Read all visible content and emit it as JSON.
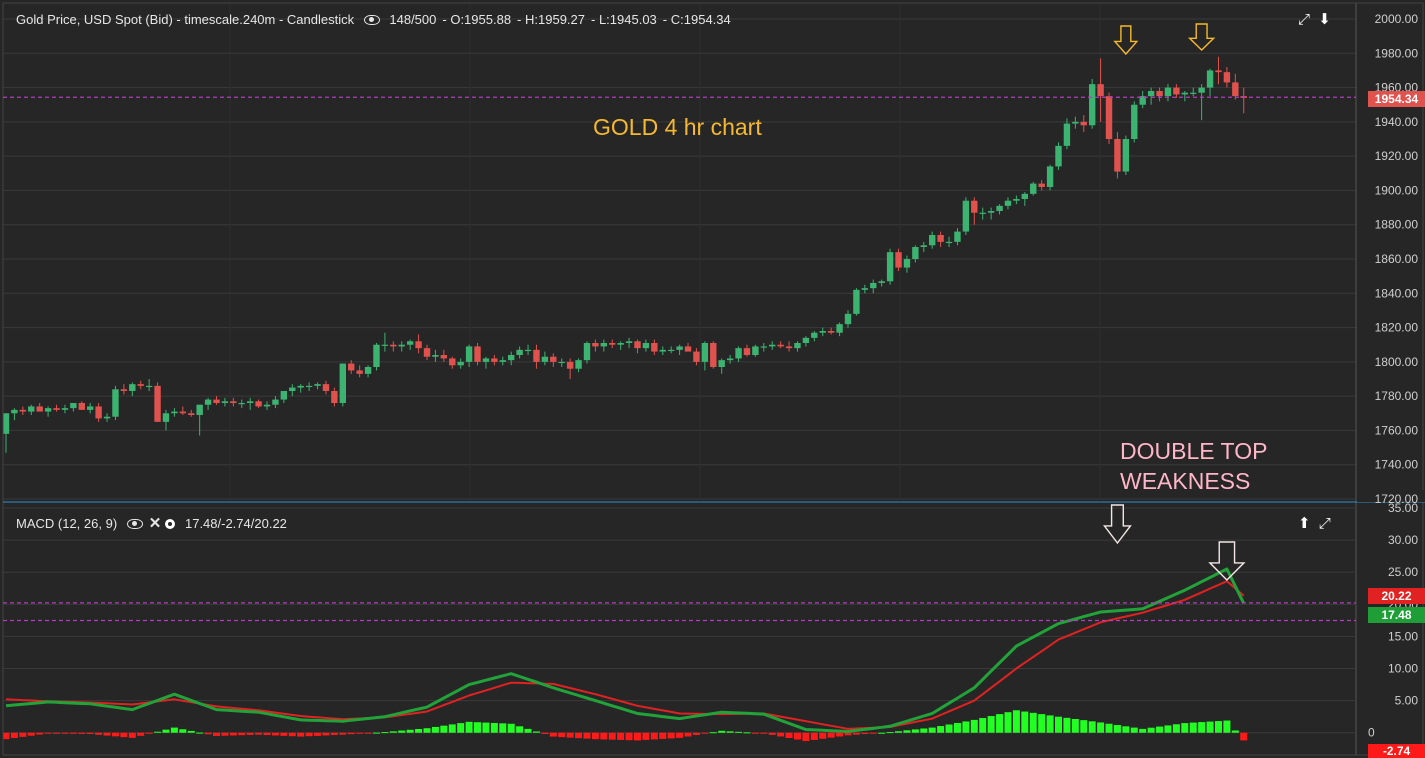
{
  "colors": {
    "background": "#262626",
    "grid": "#3a3a3a",
    "up_candle": "#3cb371",
    "down_candle": "#e0524e",
    "price_line": "#b03fbf",
    "annotation_gold": "#f5b82e",
    "annotation_pink": "#ffb6c8",
    "macd_line": "#22a33a",
    "signal_line": "#e02222",
    "hist_pos": "#22ff22",
    "hist_neg": "#ff1a1a",
    "separator": "#2f8fcf"
  },
  "price_chart": {
    "header": {
      "title": "Gold Price, USD Spot (Bid) - timescale.240m - Candlestick",
      "bars": "148/500",
      "open": "O:1955.88",
      "high": "H:1959.27",
      "low": "L:1945.03",
      "close": "C:1954.34"
    },
    "icons": [
      "eye-icon",
      "expand-icon",
      "arrow-down-icon"
    ],
    "current_price": "1954.34",
    "annotation": "GOLD 4 hr chart"
  },
  "macd_chart": {
    "header": {
      "title": "MACD (12, 26, 9)",
      "values": "17.48/-2.74/20.22"
    },
    "icons": [
      "eye-icon",
      "close-icon",
      "gear-icon",
      "arrow-up-icon",
      "expand-icon"
    ],
    "macd_value": "17.48",
    "signal_value": "20.22",
    "hist_value": "-2.74",
    "annotation_line1": "DOUBLE TOP",
    "annotation_line2": "WEAKNESS"
  },
  "chart_data": [
    {
      "type": "candlestick",
      "title": "Gold Price, USD Spot (Bid) - timescale.240m - Candlestick",
      "ylim": [
        1720,
        2000
      ],
      "y_ticks": [
        "2000.00",
        "1980.00",
        "1960.00",
        "1940.00",
        "1920.00",
        "1900.00",
        "1880.00",
        "1860.00",
        "1840.00",
        "1820.00",
        "1800.00",
        "1780.00",
        "1760.00",
        "1740.00",
        "1720.00"
      ],
      "y_tick_values": [
        2000,
        1980,
        1960,
        1940,
        1920,
        1900,
        1880,
        1860,
        1840,
        1820,
        1800,
        1780,
        1760,
        1740,
        1720
      ],
      "current_price": 1954.34,
      "x": [
        0,
        1,
        2,
        3,
        4,
        5,
        6,
        7,
        8,
        9,
        10,
        11,
        12,
        13,
        14,
        15,
        16,
        17,
        18,
        19,
        20,
        21,
        22,
        23,
        24,
        25,
        26,
        27,
        28,
        29,
        30,
        31,
        32,
        33,
        34,
        35,
        36,
        37,
        38,
        39,
        40,
        41,
        42,
        43,
        44,
        45,
        46,
        47,
        48,
        49,
        50,
        51,
        52,
        53,
        54,
        55,
        56,
        57,
        58,
        59,
        60,
        61,
        62,
        63,
        64,
        65,
        66,
        67,
        68,
        69,
        70,
        71,
        72,
        73,
        74,
        75,
        76,
        77,
        78,
        79,
        80,
        81,
        82,
        83,
        84,
        85,
        86,
        87,
        88,
        89,
        90,
        91,
        92,
        93,
        94,
        95,
        96,
        97,
        98,
        99,
        100,
        101,
        102,
        103,
        104,
        105,
        106,
        107,
        108,
        109,
        110,
        111,
        112,
        113,
        114,
        115,
        116,
        117,
        118,
        119,
        120,
        121,
        122,
        123,
        124,
        125,
        126,
        127,
        128,
        129,
        130,
        131,
        132,
        133,
        134,
        135,
        136,
        137,
        138,
        139,
        140,
        141,
        142,
        143,
        144,
        145,
        146,
        147
      ],
      "open": [
        1758,
        1770,
        1772,
        1771,
        1774,
        1771,
        1773,
        1772,
        1773,
        1776,
        1772,
        1774,
        1767,
        1768,
        1784,
        1783,
        1787,
        1786,
        1786,
        1765,
        1770,
        1771,
        1770,
        1769,
        1775,
        1778,
        1776,
        1777,
        1776,
        1776,
        1777,
        1774,
        1775,
        1778,
        1783,
        1785,
        1786,
        1786,
        1787,
        1783,
        1776,
        1799,
        1795,
        1793,
        1797,
        1810,
        1810,
        1809,
        1810,
        1812,
        1808,
        1803,
        1804,
        1802,
        1798,
        1800,
        1809,
        1800,
        1802,
        1800,
        1801,
        1804,
        1807,
        1807,
        1800,
        1803,
        1800,
        1800,
        1796,
        1801,
        1811,
        1809,
        1811,
        1810,
        1811,
        1812,
        1808,
        1811,
        1806,
        1807,
        1807,
        1809,
        1806,
        1800,
        1811,
        1797,
        1801,
        1802,
        1808,
        1804,
        1809,
        1809,
        1810,
        1809,
        1808,
        1811,
        1814,
        1817,
        1818,
        1817,
        1822,
        1828,
        1842,
        1843,
        1846,
        1847,
        1864,
        1855,
        1860,
        1867,
        1868,
        1874,
        1870,
        1870,
        1876,
        1894,
        1887,
        1887,
        1888,
        1891,
        1894,
        1895,
        1898,
        1904,
        1902,
        1914,
        1926,
        1939,
        1940,
        1938,
        1962,
        1955,
        1930,
        1911,
        1930,
        1950,
        1955,
        1958,
        1955,
        1960,
        1956,
        1957,
        1957,
        1960,
        1970,
        1969,
        1963,
        1955
      ],
      "high": [
        1770,
        1773,
        1774,
        1775,
        1776,
        1774,
        1775,
        1775,
        1776,
        1777,
        1776,
        1776,
        1770,
        1786,
        1787,
        1788,
        1789,
        1790,
        1788,
        1772,
        1773,
        1774,
        1772,
        1775,
        1779,
        1780,
        1779,
        1779,
        1778,
        1779,
        1778,
        1777,
        1780,
        1783,
        1787,
        1787,
        1788,
        1788,
        1789,
        1785,
        1799,
        1801,
        1798,
        1798,
        1811,
        1817,
        1812,
        1812,
        1813,
        1816,
        1810,
        1807,
        1807,
        1803,
        1802,
        1810,
        1811,
        1803,
        1804,
        1803,
        1806,
        1809,
        1810,
        1810,
        1806,
        1805,
        1802,
        1802,
        1802,
        1812,
        1813,
        1813,
        1813,
        1812,
        1814,
        1813,
        1813,
        1813,
        1809,
        1809,
        1810,
        1811,
        1808,
        1812,
        1812,
        1802,
        1804,
        1809,
        1810,
        1810,
        1811,
        1812,
        1812,
        1812,
        1812,
        1815,
        1818,
        1820,
        1820,
        1823,
        1830,
        1843,
        1845,
        1848,
        1848,
        1866,
        1866,
        1862,
        1868,
        1870,
        1876,
        1876,
        1873,
        1878,
        1896,
        1896,
        1890,
        1890,
        1892,
        1896,
        1897,
        1899,
        1905,
        1906,
        1915,
        1928,
        1942,
        1943,
        1944,
        1965,
        1977,
        1957,
        1934,
        1932,
        1952,
        1958,
        1960,
        1960,
        1962,
        1962,
        1958,
        1960,
        1962,
        1971,
        1978,
        1972,
        1968,
        1960
      ],
      "low": [
        1747,
        1766,
        1769,
        1769,
        1771,
        1768,
        1771,
        1770,
        1771,
        1772,
        1770,
        1765,
        1765,
        1766,
        1781,
        1780,
        1784,
        1783,
        1765,
        1760,
        1768,
        1769,
        1768,
        1757,
        1772,
        1775,
        1774,
        1774,
        1773,
        1772,
        1773,
        1772,
        1773,
        1776,
        1780,
        1782,
        1783,
        1784,
        1781,
        1774,
        1774,
        1793,
        1791,
        1791,
        1795,
        1806,
        1806,
        1806,
        1807,
        1805,
        1801,
        1800,
        1800,
        1796,
        1796,
        1797,
        1798,
        1796,
        1798,
        1798,
        1798,
        1802,
        1804,
        1796,
        1798,
        1797,
        1797,
        1790,
        1794,
        1799,
        1806,
        1806,
        1808,
        1807,
        1808,
        1805,
        1806,
        1804,
        1804,
        1805,
        1804,
        1806,
        1798,
        1795,
        1796,
        1793,
        1799,
        1800,
        1803,
        1803,
        1806,
        1807,
        1808,
        1806,
        1806,
        1809,
        1812,
        1815,
        1816,
        1815,
        1820,
        1827,
        1840,
        1840,
        1844,
        1845,
        1853,
        1852,
        1858,
        1864,
        1866,
        1867,
        1867,
        1868,
        1874,
        1880,
        1883,
        1883,
        1886,
        1889,
        1892,
        1891,
        1897,
        1900,
        1900,
        1912,
        1924,
        1936,
        1934,
        1936,
        1940,
        1927,
        1907,
        1909,
        1928,
        1948,
        1950,
        1952,
        1952,
        1954,
        1952,
        1955,
        1941,
        1955,
        1962,
        1960,
        1953,
        1945
      ],
      "close": [
        1770,
        1772,
        1771,
        1774,
        1771,
        1773,
        1772,
        1773,
        1776,
        1772,
        1774,
        1767,
        1768,
        1784,
        1783,
        1787,
        1786,
        1786,
        1765,
        1770,
        1771,
        1770,
        1769,
        1775,
        1778,
        1776,
        1777,
        1776,
        1776,
        1777,
        1774,
        1775,
        1778,
        1783,
        1785,
        1786,
        1786,
        1787,
        1783,
        1776,
        1799,
        1795,
        1793,
        1797,
        1810,
        1810,
        1809,
        1810,
        1812,
        1808,
        1803,
        1804,
        1802,
        1798,
        1800,
        1809,
        1800,
        1802,
        1800,
        1801,
        1804,
        1807,
        1807,
        1800,
        1803,
        1800,
        1800,
        1796,
        1801,
        1811,
        1809,
        1811,
        1810,
        1811,
        1812,
        1808,
        1811,
        1806,
        1807,
        1807,
        1809,
        1806,
        1800,
        1811,
        1797,
        1801,
        1802,
        1808,
        1804,
        1809,
        1809,
        1810,
        1809,
        1808,
        1811,
        1814,
        1817,
        1818,
        1817,
        1822,
        1828,
        1842,
        1843,
        1846,
        1847,
        1864,
        1855,
        1860,
        1867,
        1868,
        1874,
        1870,
        1870,
        1876,
        1894,
        1887,
        1887,
        1888,
        1891,
        1894,
        1895,
        1898,
        1904,
        1902,
        1914,
        1926,
        1939,
        1940,
        1938,
        1962,
        1955,
        1930,
        1911,
        1930,
        1950,
        1955,
        1958,
        1955,
        1960,
        1956,
        1957,
        1957,
        1960,
        1970,
        1969,
        1963,
        1955,
        1954
      ]
    },
    {
      "type": "line",
      "title": "MACD (12, 26, 9)",
      "ylim": [
        -3,
        35
      ],
      "y_ticks": [
        "35.00",
        "30.00",
        "25.00",
        "20.00",
        "15.00",
        "10.00",
        "5.00",
        "0"
      ],
      "y_tick_values": [
        35,
        30,
        25,
        20,
        15,
        10,
        5,
        0
      ],
      "x": [
        0,
        5,
        10,
        15,
        20,
        25,
        30,
        35,
        40,
        45,
        50,
        55,
        60,
        65,
        70,
        75,
        80,
        85,
        90,
        95,
        100,
        105,
        110,
        115,
        120,
        125,
        130,
        135,
        140,
        145,
        148
      ],
      "series": [
        {
          "name": "MACD",
          "values": [
            4.2,
            4.8,
            4.5,
            3.6,
            6.0,
            3.6,
            3.2,
            2.0,
            1.8,
            2.5,
            4.0,
            7.5,
            9.2,
            7.0,
            5.0,
            3.0,
            2.2,
            3.2,
            2.9,
            0.5,
            0.2,
            1.0,
            3.0,
            7.0,
            13.5,
            17.0,
            18.8,
            19.3,
            22.2,
            25.5,
            17.48
          ]
        },
        {
          "name": "Signal",
          "values": [
            5.2,
            4.9,
            4.7,
            4.4,
            5.2,
            4.1,
            3.5,
            2.6,
            2.1,
            2.4,
            3.3,
            5.8,
            7.8,
            7.6,
            6.0,
            4.2,
            3.0,
            2.9,
            3.0,
            1.8,
            0.6,
            0.9,
            2.2,
            5.0,
            10.0,
            14.5,
            17.2,
            18.7,
            20.7,
            23.6,
            20.22
          ]
        },
        {
          "name": "Histogram",
          "values": [
            -1.0,
            -0.1,
            -0.2,
            -0.8,
            0.8,
            -0.5,
            -0.3,
            -0.6,
            -0.3,
            0.1,
            0.7,
            1.7,
            1.4,
            -0.6,
            -1.0,
            -1.2,
            -0.8,
            0.3,
            -0.1,
            -1.3,
            -0.4,
            0.1,
            0.8,
            2.0,
            3.5,
            2.5,
            1.6,
            0.6,
            1.5,
            1.9,
            -2.74
          ]
        }
      ]
    }
  ]
}
